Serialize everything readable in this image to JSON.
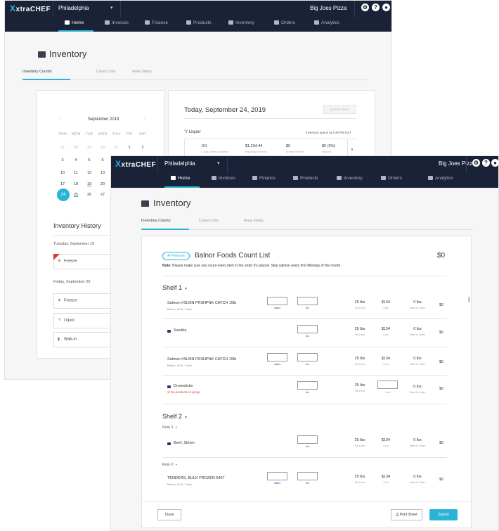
{
  "brand": {
    "name": "xtraCHEF",
    "mark": "X"
  },
  "location": "Philadelphia",
  "business": "Big Joes Pizza",
  "nav": [
    {
      "label": "Home",
      "icon": "home-icon"
    },
    {
      "label": "Invoices",
      "icon": "invoice-icon"
    },
    {
      "label": "Finance",
      "icon": "finance-icon"
    },
    {
      "label": "Products",
      "icon": "products-icon"
    },
    {
      "label": "Inventory",
      "icon": "inventory-icon"
    },
    {
      "label": "Orders",
      "icon": "orders-icon"
    },
    {
      "label": "Analytics",
      "icon": "analytics-icon"
    }
  ],
  "page_title": "Inventory",
  "subtabs": [
    "Inventory Counts",
    "Count Lists",
    "Area Setup"
  ],
  "calendar": {
    "month": "September 2019",
    "dow": [
      "SUN",
      "MON",
      "TUE",
      "WED",
      "THU",
      "FRI",
      "SAT"
    ],
    "weeks": [
      [
        "27",
        "28",
        "29",
        "30",
        "31",
        "1",
        "2"
      ],
      [
        "3",
        "4",
        "5",
        "6"
      ],
      [
        "10",
        "11",
        "12",
        "13"
      ],
      [
        "17",
        "18",
        "19",
        "20"
      ],
      [
        "24",
        "25",
        "26",
        "27"
      ]
    ],
    "selected": "24"
  },
  "history": {
    "title": "Inventory History",
    "date1": "Tuesday, September 19",
    "date2": "Friday, September 20",
    "items": [
      "Freezer",
      "Freezer",
      "Liquor",
      "Walk-in"
    ]
  },
  "today": {
    "title": "Today, September 24, 2019",
    "print_label": "Print Sheet",
    "area": "Liquor",
    "opens": "Inventory opens at 2:40 PM EST",
    "stats": [
      {
        "value": "0/1",
        "label": "Count Sheets completed"
      },
      {
        "value": "$1,234.44",
        "label": "Beginning Inventory"
      },
      {
        "value": "$0",
        "label": "Ending Inventory"
      },
      {
        "value": "$0 (0%)",
        "label": "Variance"
      }
    ]
  },
  "count_list": {
    "area_pill": "Freezer",
    "title": "Balnor Foods Count List",
    "total": "$0",
    "note_label": "Note:",
    "note": "Please make sure you count every item in the order it's placed. Skip salmon every first Monday of the month.",
    "shelves": [
      {
        "name": "Shelf 1",
        "items": [
          {
            "name": "Salmon #SLMN FRSHPNK CATCH 15lb",
            "sub": "Balnor, 10 lb / Case",
            "in1": "cases",
            "in2": "lbs",
            "par": "25 lbs",
            "par_l": "Par Level",
            "cost": "$134",
            "cost_l": "Cost",
            "need": "0 lbs",
            "need_l": "Need to Order",
            "sum": "$0"
          },
          {
            "name": "Svedka",
            "sub": "",
            "in1": "",
            "in2": "lbs",
            "par": "25 lbs",
            "par_l": "Par Level",
            "cost": "$134",
            "cost_l": "Cost",
            "need": "0 lbs",
            "need_l": "Need to Order",
            "sum": "$0"
          },
          {
            "name": "Salmon #SLMN FRSHPNK CATCH 15lb",
            "sub": "Balnor, 10 lb / Case",
            "in1": "cases",
            "in2": "lbs",
            "par": "25 lbs",
            "par_l": "Par Level",
            "cost": "$134",
            "cost_l": "Cost",
            "need": "0 lbs",
            "need_l": "Need to Order",
            "sum": "$0"
          },
          {
            "name": "Drumsticks",
            "warn": "No products in group",
            "in1": "",
            "in2": "lbs",
            "par": "25 lbs",
            "par_l": "Par Level",
            "cost": "",
            "cost_l": "Cost",
            "need": "0 lbs",
            "need_l": "Need to Order",
            "sum": "$0"
          }
        ]
      },
      {
        "name": "Shelf 2",
        "rows": [
          {
            "name": "Row 1",
            "item": {
              "name": "Beef, Sirloin",
              "in2": "lbs",
              "par": "25 lbs",
              "par_l": "Par Level",
              "cost": "$134",
              "cost_l": "Cost",
              "need": "0 lbs",
              "need_l": "Need to Order",
              "sum": "$0"
            }
          },
          {
            "name": "Row 2",
            "item": {
              "name": "TENDERS, BULK FROZEN 5467",
              "sub": "Balnor, 10 lb / Case",
              "in1": "cases",
              "in2": "lbs",
              "par": "25 lbs",
              "par_l": "Par Level",
              "cost": "$134",
              "cost_l": "Cost",
              "need": "0 lbs",
              "need_l": "Need to Order",
              "sum": "$0"
            }
          }
        ]
      }
    ],
    "close_label": "Close",
    "print_label": "Print Sheet",
    "submit_label": "Submit"
  },
  "colors": {
    "navbar": "#1a2238",
    "accent": "#2ab4d6",
    "warn": "#d93a3a"
  }
}
